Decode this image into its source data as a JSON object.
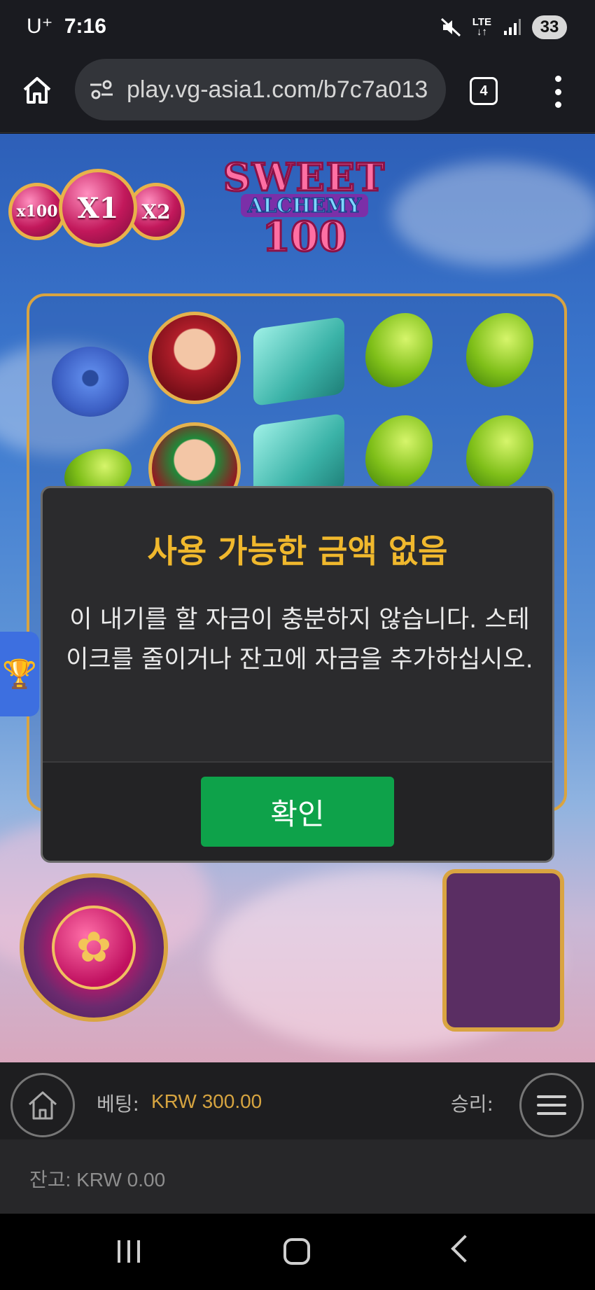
{
  "status_bar": {
    "carrier": "U⁺",
    "time": "7:16",
    "network": "LTE",
    "battery": "33"
  },
  "browser": {
    "url": "play.vg-asia1.com/b7c7a013",
    "tab_count": "4"
  },
  "game": {
    "logo": {
      "line1": "SWEET",
      "line2": "ALCHEMY",
      "line3": "100"
    },
    "multipliers": [
      "x100",
      "X1",
      "X2"
    ],
    "symbols_icon_names": [
      "donut-candy",
      "red-hat-girl",
      "teal-cube-candy",
      "green-jelly-bean",
      "green-jelly-bean",
      "green-jelly-bean",
      "green-hat-girl",
      "teal-cube-candy",
      "green-jelly-bean",
      "green-jelly-bean"
    ]
  },
  "dialog": {
    "title": "사용 가능한 금액 없음",
    "message": "이 내기를 할 자금이 충분하지 않습니다. 스테이크를 줄이거나 잔고에 자금을 추가하십시오.",
    "ok_label": "확인"
  },
  "bottom_bar": {
    "bet_label": "베팅:",
    "bet_value": "KRW 300.00",
    "win_label": "승리:"
  },
  "balance": {
    "text": "잔고: KRW 0.00"
  },
  "colors": {
    "dialog_title": "#f0b82d",
    "ok_button": "#0ea24a",
    "bet_value": "#d6a440"
  }
}
